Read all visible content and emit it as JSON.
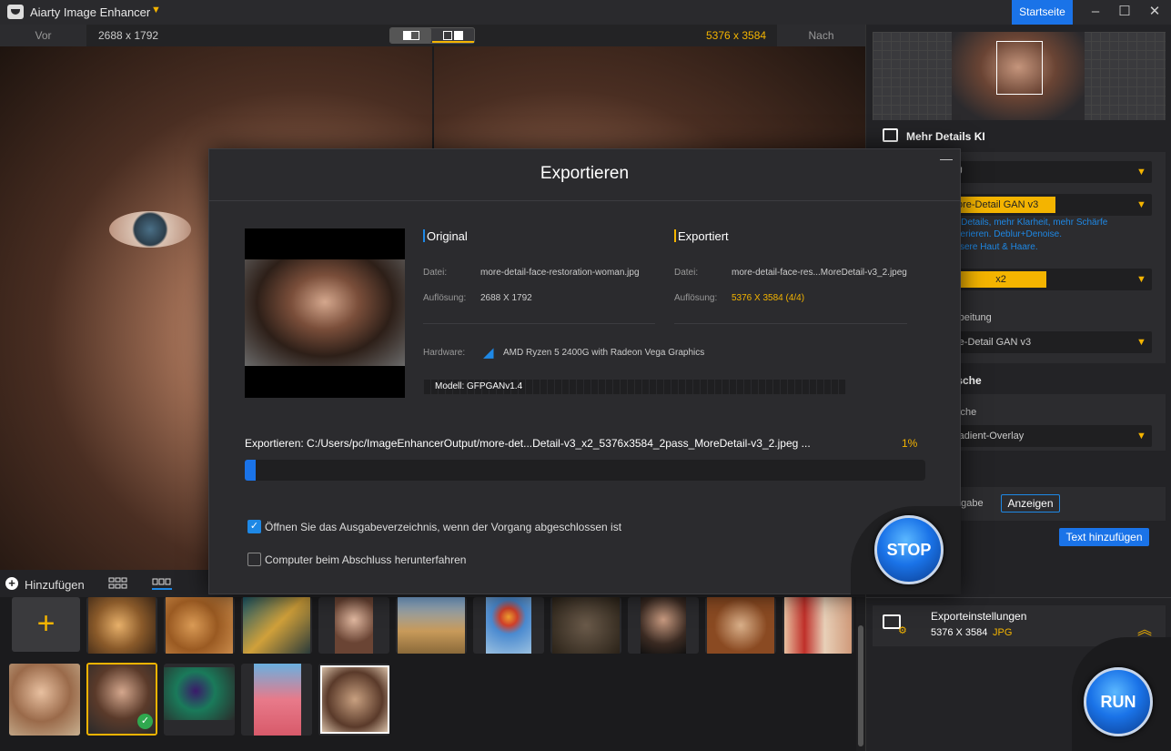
{
  "app": {
    "title": "Aiarty Image Enhancer",
    "startseite": "Startseite"
  },
  "compare": {
    "vor": "Vor",
    "orig_res": "2688 x 1792",
    "nach_res": "5376 x 3584",
    "nach": "Nach"
  },
  "right_panel": {
    "section_title": "Mehr Details KI",
    "dd1_value": "U",
    "model_chip": "ore-Detail GAN  v3",
    "desc_lines": [
      "r Details, mehr Klarheit, mehr Schärfe",
      "nerieren. Deblur+Denoise.",
      "ssere Haut & Haare."
    ],
    "scale_chip": "x2",
    "nachbearbeitung_label": "rbeitung",
    "nachbearbeitung_value": "re-Detail GAN  v3",
    "retusche_title": "tusche",
    "retusche_label": "sche",
    "retusche_value": "radient-Overlay",
    "wasser_title": "e",
    "eingabe_label": "ngabe",
    "anzeigen": "Anzeigen",
    "text_hinzufuegen": "Text hinzufügen"
  },
  "export_settings": {
    "label": "Exporteinstellungen",
    "resolution": "5376 X 3584",
    "format": "JPG"
  },
  "run_label": "RUN",
  "bottom": {
    "add_label": "Hinzufügen"
  },
  "modal": {
    "title": "Exportieren",
    "original": {
      "heading": "Original",
      "file_label": "Datei:",
      "file_value": "more-detail-face-restoration-woman.jpg",
      "res_label": "Auflösung:",
      "res_value": "2688 X 1792"
    },
    "exported": {
      "heading": "Exportiert",
      "file_label": "Datei:",
      "file_value": "more-detail-face-res...MoreDetail-v3_2.jpeg",
      "res_label": "Auflösung:",
      "res_value": "5376 X 3584 (4/4)"
    },
    "hardware_label": "Hardware:",
    "hardware_value": "AMD Ryzen 5 2400G with Radeon Vega Graphics",
    "model_label": "Modell: GFPGANv1.4",
    "export_path": "Exportieren: C:/Users/pc/ImageEnhancerOutput/more-det...Detail-v3_x2_5376x3584_2pass_MoreDetail-v3_2.jpeg ...",
    "progress_text": "1%",
    "progress_value": 0.01,
    "open_folder_label": "Öffnen Sie das Ausgabeverzeichnis, wenn der Vorgang abgeschlossen ist",
    "open_folder_checked": true,
    "shutdown_label": "Computer beim Abschluss herunterfahren",
    "shutdown_checked": false,
    "stop_label": "STOP"
  },
  "colors": {
    "accent": "#f4b400",
    "blue": "#1a73e8"
  }
}
